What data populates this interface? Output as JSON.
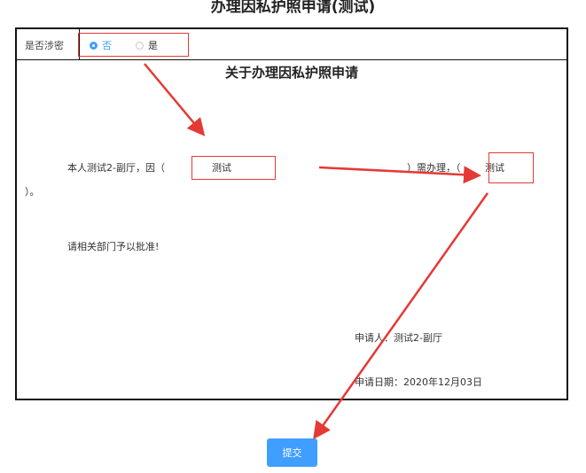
{
  "page": {
    "title": "办理因私护照申请(测试)"
  },
  "form": {
    "secret_label": "是否涉密",
    "options": {
      "no": "否",
      "yes": "是"
    },
    "selected": "no"
  },
  "document": {
    "title": "关于办理因私护照申请",
    "line1_prefix": "本人测试2-副厅，因（",
    "reason_value": "测试",
    "line1_middle": "）需办理，（",
    "item_value": "测试",
    "line2": "）。",
    "approval": "请相关部门予以批准!",
    "applicant_label": "申请人：",
    "applicant_name": "测试2-副厅",
    "date_label": "申请日期：",
    "date_value": "2020年12月03日"
  },
  "actions": {
    "submit": "提交"
  },
  "colors": {
    "accent": "#409eff",
    "annotation": "#e53935"
  }
}
